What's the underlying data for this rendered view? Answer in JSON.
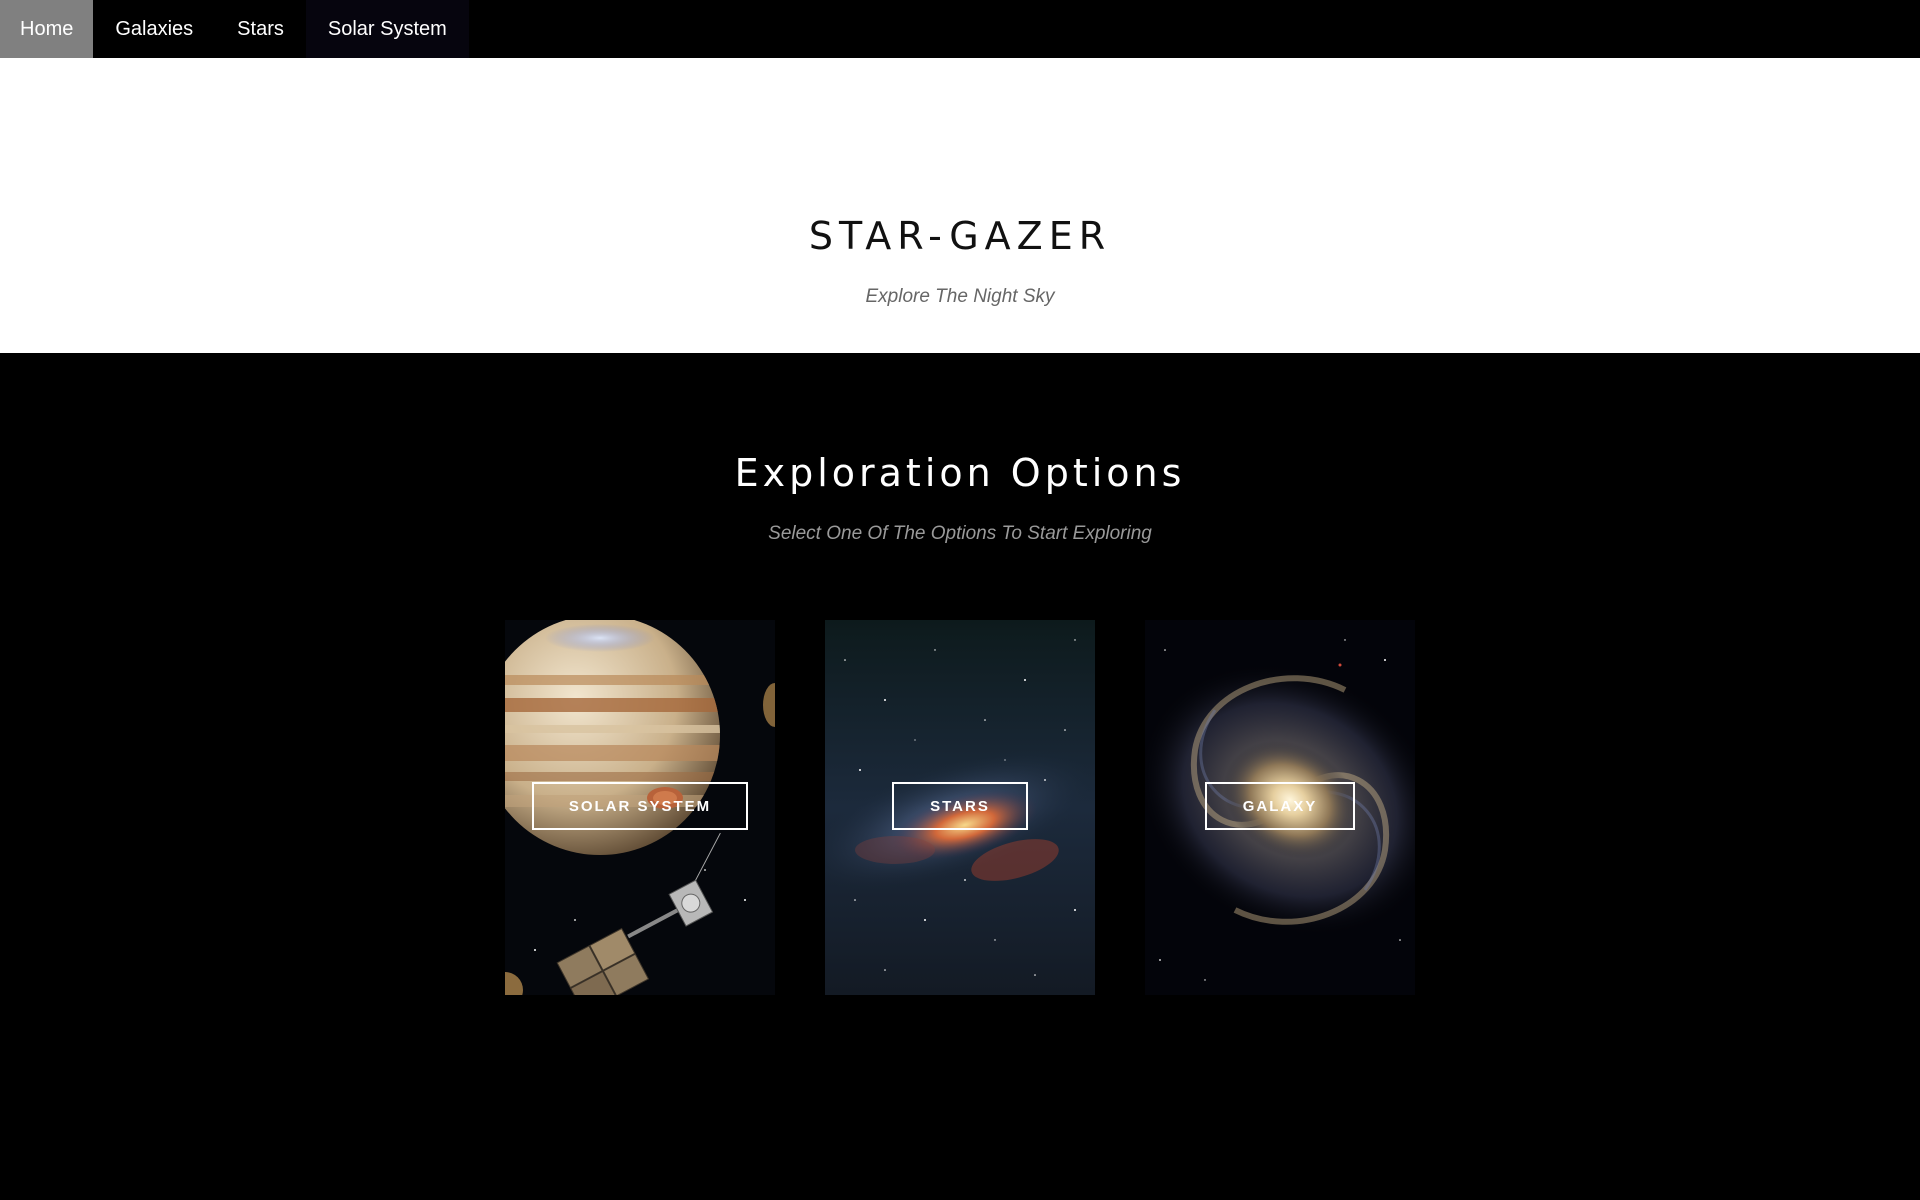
{
  "nav": {
    "items": [
      {
        "label": "Home",
        "active": true
      },
      {
        "label": "Galaxies",
        "active": false
      },
      {
        "label": "Stars",
        "active": false
      },
      {
        "label": "Solar System",
        "active": false
      }
    ]
  },
  "hero": {
    "title": "STAR-GAZER",
    "subtitle": "Explore The Night Sky"
  },
  "exploration": {
    "heading": "Exploration Options",
    "subheading": "Select One Of The Options To Start Exploring",
    "cards": [
      {
        "label": "SOLAR SYSTEM",
        "image": "jupiter-with-spacecraft"
      },
      {
        "label": "STARS",
        "image": "milky-way-starfield"
      },
      {
        "label": "GALAXY",
        "image": "spiral-galaxy"
      }
    ]
  },
  "colors": {
    "nav_background": "#000000",
    "nav_active": "#808080",
    "hero_background": "#ffffff",
    "section_background": "#000000"
  }
}
